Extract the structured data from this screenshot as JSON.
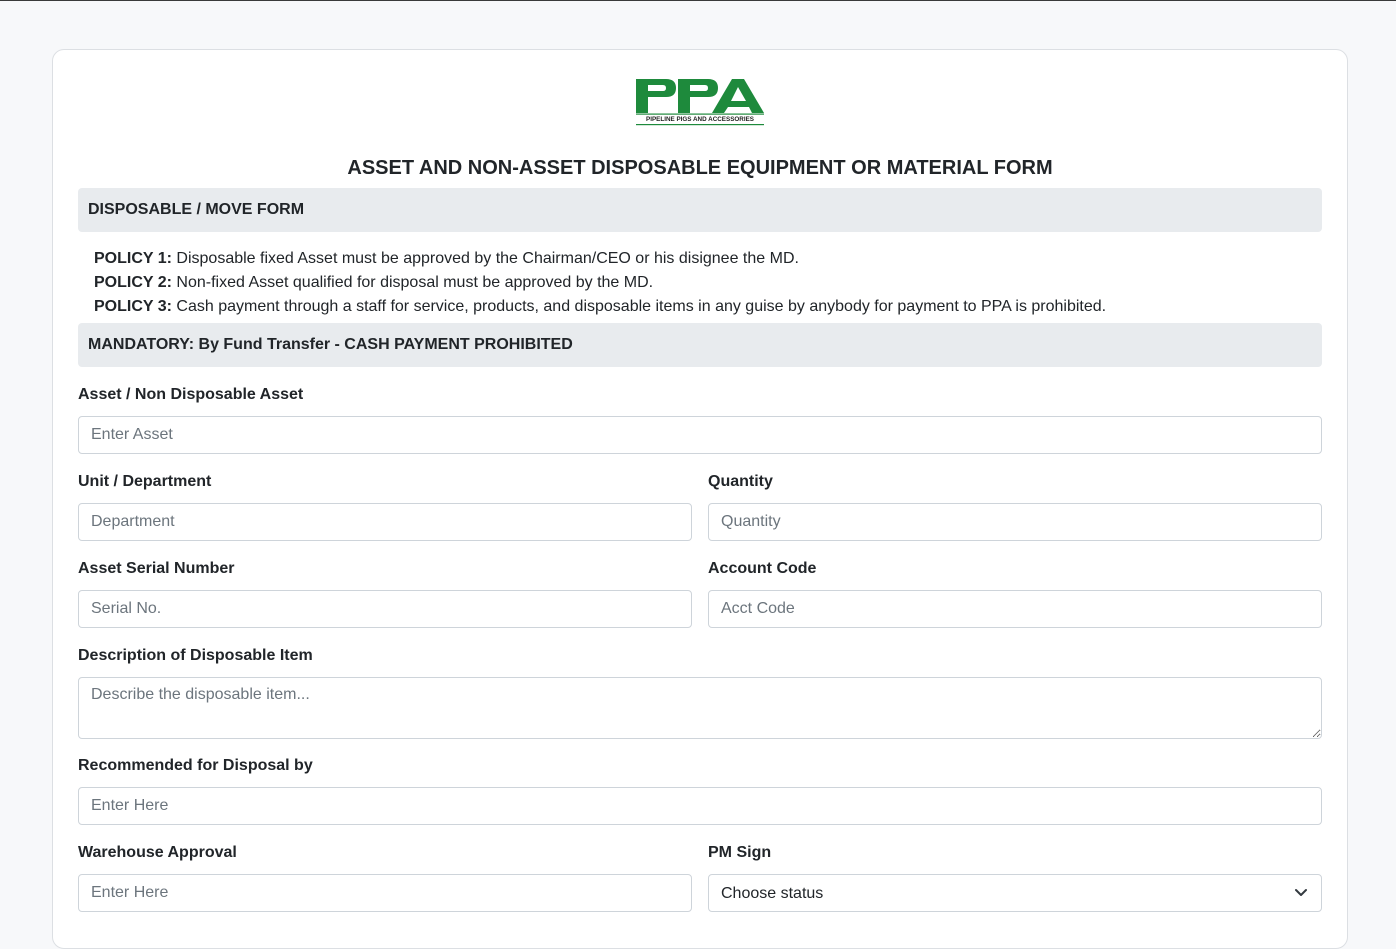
{
  "logo": {
    "text": "PPA",
    "tagline": "PIPELINE PIGS AND ACCESSORIES",
    "color": "#1e8a3c"
  },
  "form": {
    "title": "ASSET AND NON-ASSET DISPOSABLE EQUIPMENT OR MATERIAL FORM",
    "section_disposable": "DISPOSABLE / MOVE FORM",
    "policies": [
      {
        "label": "POLICY 1:",
        "text": "Disposable fixed Asset must be approved by the Chairman/CEO or his disignee the MD."
      },
      {
        "label": "POLICY 2:",
        "text": "Non-fixed Asset qualified for disposal must be approved by the MD."
      },
      {
        "label": "POLICY 3:",
        "text": "Cash payment through a staff for service, products, and disposable items in any guise by anybody for payment to PPA is prohibited."
      }
    ],
    "section_mandatory": "MANDATORY: By Fund Transfer - CASH PAYMENT PROHIBITED",
    "fields": {
      "asset": {
        "label": "Asset / Non Disposable Asset",
        "placeholder": "Enter Asset",
        "value": ""
      },
      "department": {
        "label": "Unit / Department",
        "placeholder": "Department",
        "value": ""
      },
      "quantity": {
        "label": "Quantity",
        "placeholder": "Quantity",
        "value": ""
      },
      "serial": {
        "label": "Asset Serial Number",
        "placeholder": "Serial No.",
        "value": ""
      },
      "account_code": {
        "label": "Account Code",
        "placeholder": "Acct Code",
        "value": ""
      },
      "description": {
        "label": "Description of Disposable Item",
        "placeholder": "Describe the disposable item...",
        "value": ""
      },
      "recommended_by": {
        "label": "Recommended for Disposal by",
        "placeholder": "Enter Here",
        "value": ""
      },
      "warehouse_approval": {
        "label": "Warehouse Approval",
        "placeholder": "Enter Here",
        "value": ""
      },
      "pm_sign": {
        "label": "PM Sign",
        "selected": "Choose status"
      }
    }
  },
  "icons": {
    "select_chevron": "chevron-down-icon"
  }
}
